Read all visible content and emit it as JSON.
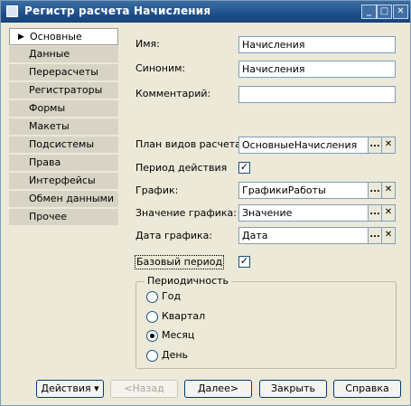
{
  "window": {
    "title": "Регистр расчета Начисления",
    "controls": {
      "minimize": "_",
      "maximize": "□",
      "close": "✕"
    }
  },
  "nav": {
    "items": [
      {
        "label": "Основные",
        "active": true
      },
      {
        "label": "Данные"
      },
      {
        "label": "Перерасчеты"
      },
      {
        "label": "Регистраторы"
      },
      {
        "label": "Формы"
      },
      {
        "label": "Макеты"
      },
      {
        "label": "Подсистемы"
      },
      {
        "label": "Права"
      },
      {
        "label": "Интерфейсы"
      },
      {
        "label": "Обмен данными"
      },
      {
        "label": "Прочее"
      }
    ]
  },
  "form": {
    "name_label": "Имя:",
    "name_value": "Начисления",
    "synonym_label": "Синоним:",
    "synonym_value": "Начисления",
    "comment_label": "Комментарий:",
    "comment_value": "",
    "plan_label": "План видов расчета:",
    "plan_value": "ОсновныеНачисления",
    "period_label": "Период действия",
    "period_checked": true,
    "schedule_label": "График:",
    "schedule_value": "ГрафикиРаботы",
    "schedule_value_label": "Значение графика:",
    "schedule_value_value": "Значение",
    "schedule_date_label": "Дата графика:",
    "schedule_date_value": "Дата",
    "base_period_label": "Базовый период",
    "base_period_checked": true,
    "select_glyph": "...",
    "clear_glyph": "✕",
    "check_glyph": "✓"
  },
  "periodicity": {
    "title": "Периодичность",
    "options": [
      {
        "label": "Год",
        "selected": false
      },
      {
        "label": "Квартал",
        "selected": false
      },
      {
        "label": "Месяц",
        "selected": true
      },
      {
        "label": "День",
        "selected": false
      }
    ]
  },
  "buttons": {
    "actions": "Действия",
    "actions_arrow": "▾",
    "back": "<Назад",
    "next": "Далее>",
    "close": "Закрыть",
    "help": "Справка"
  }
}
